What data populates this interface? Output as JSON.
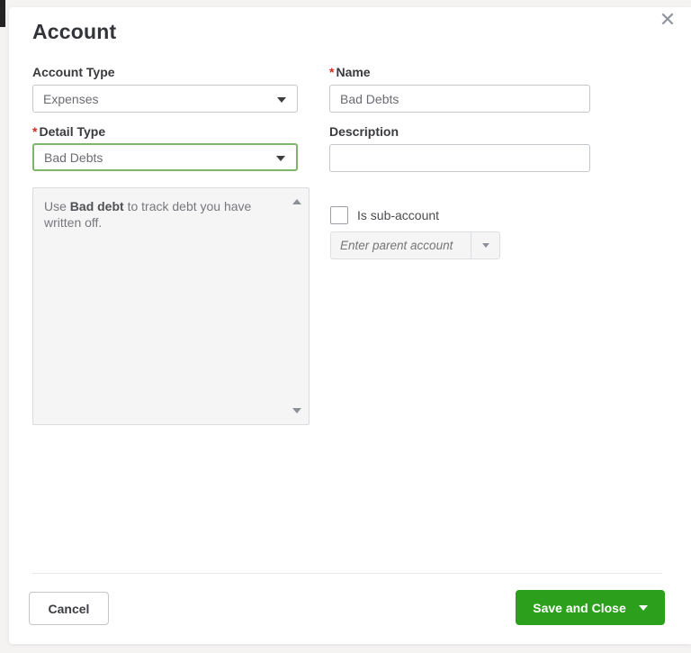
{
  "dialog": {
    "title": "Account",
    "close_glyph": "✕"
  },
  "fields": {
    "account_type": {
      "label": "Account Type",
      "value": "Expenses"
    },
    "name": {
      "label": "Name",
      "required_mark": "*",
      "value": "Bad Debts"
    },
    "detail_type": {
      "label": "Detail Type",
      "required_mark": "*",
      "value": "Bad Debts"
    },
    "description": {
      "label": "Description",
      "value": ""
    },
    "detail_info": {
      "prefix": "Use ",
      "bold": "Bad debt",
      "suffix": " to track debt you have written off."
    },
    "sub_account": {
      "label": "Is sub-account",
      "checked": false
    },
    "parent_account": {
      "placeholder": "Enter parent account"
    }
  },
  "footer": {
    "cancel_label": "Cancel",
    "save_label": "Save and Close"
  },
  "colors": {
    "accent_green": "#2ca01c",
    "required_red": "#d52b1e",
    "focus_border_green": "#7db56d"
  }
}
